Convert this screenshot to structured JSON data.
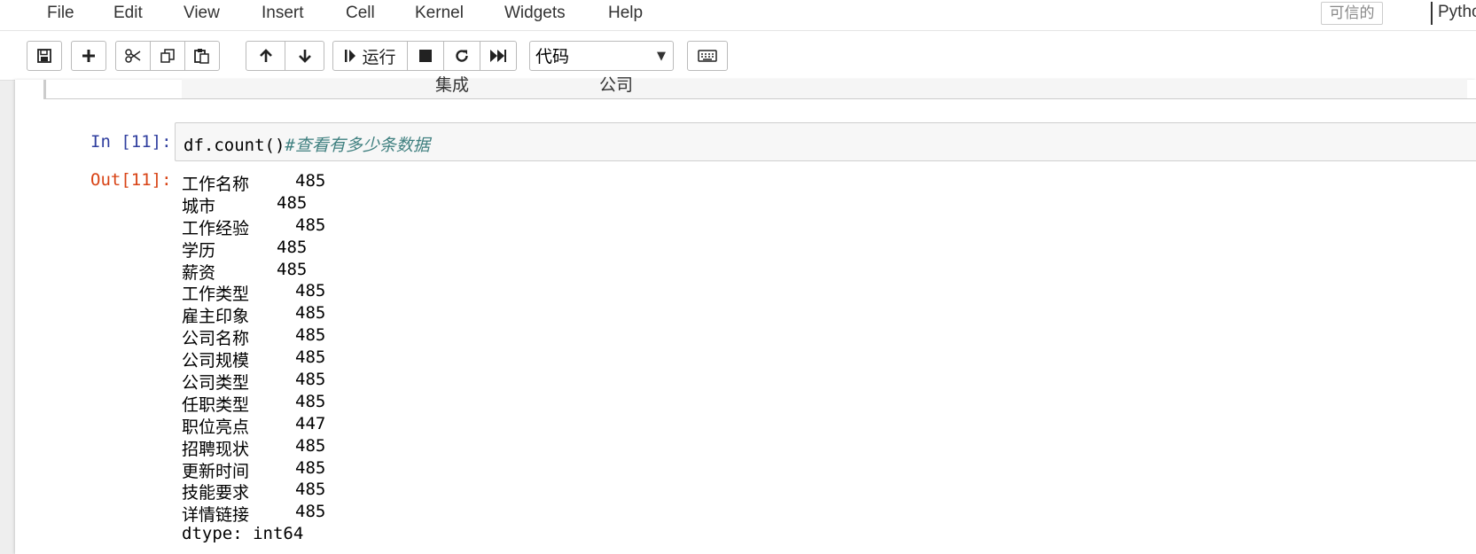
{
  "menubar": {
    "items": [
      "File",
      "Edit",
      "View",
      "Insert",
      "Cell",
      "Kernel",
      "Widgets",
      "Help"
    ],
    "trusted_label": "可信的",
    "kernel_name": "Pytho"
  },
  "toolbar": {
    "run_label": "运行",
    "cell_type": "代码",
    "icons": [
      "save-icon",
      "plus-icon",
      "cut-icon",
      "copy-icon",
      "paste-icon",
      "arrow-up-icon",
      "arrow-down-icon",
      "step-icon",
      "stop-icon",
      "restart-icon",
      "fast-forward-icon",
      "keyboard-icon"
    ]
  },
  "previous_output": {
    "cells": [
      "集成",
      "公司"
    ]
  },
  "cell": {
    "in_prompt": "In [11]:",
    "code": "df.count()",
    "comment": "#查看有多少条数据",
    "out_prompt": "Out[11]:",
    "output_rows": [
      {
        "key": "工作名称",
        "value": "485"
      },
      {
        "key": "城市",
        "value": "485"
      },
      {
        "key": "工作经验",
        "value": "485"
      },
      {
        "key": "学历",
        "value": "485"
      },
      {
        "key": "薪资",
        "value": "485"
      },
      {
        "key": "工作类型",
        "value": "485"
      },
      {
        "key": "雇主印象",
        "value": "485"
      },
      {
        "key": "公司名称",
        "value": "485"
      },
      {
        "key": "公司规模",
        "value": "485"
      },
      {
        "key": "公司类型",
        "value": "485"
      },
      {
        "key": "任职类型",
        "value": "485"
      },
      {
        "key": "职位亮点",
        "value": "447"
      },
      {
        "key": "招聘现状",
        "value": "485"
      },
      {
        "key": "更新时间",
        "value": "485"
      },
      {
        "key": "技能要求",
        "value": "485"
      },
      {
        "key": "详情链接",
        "value": "485"
      }
    ],
    "dtype": "dtype: int64"
  }
}
